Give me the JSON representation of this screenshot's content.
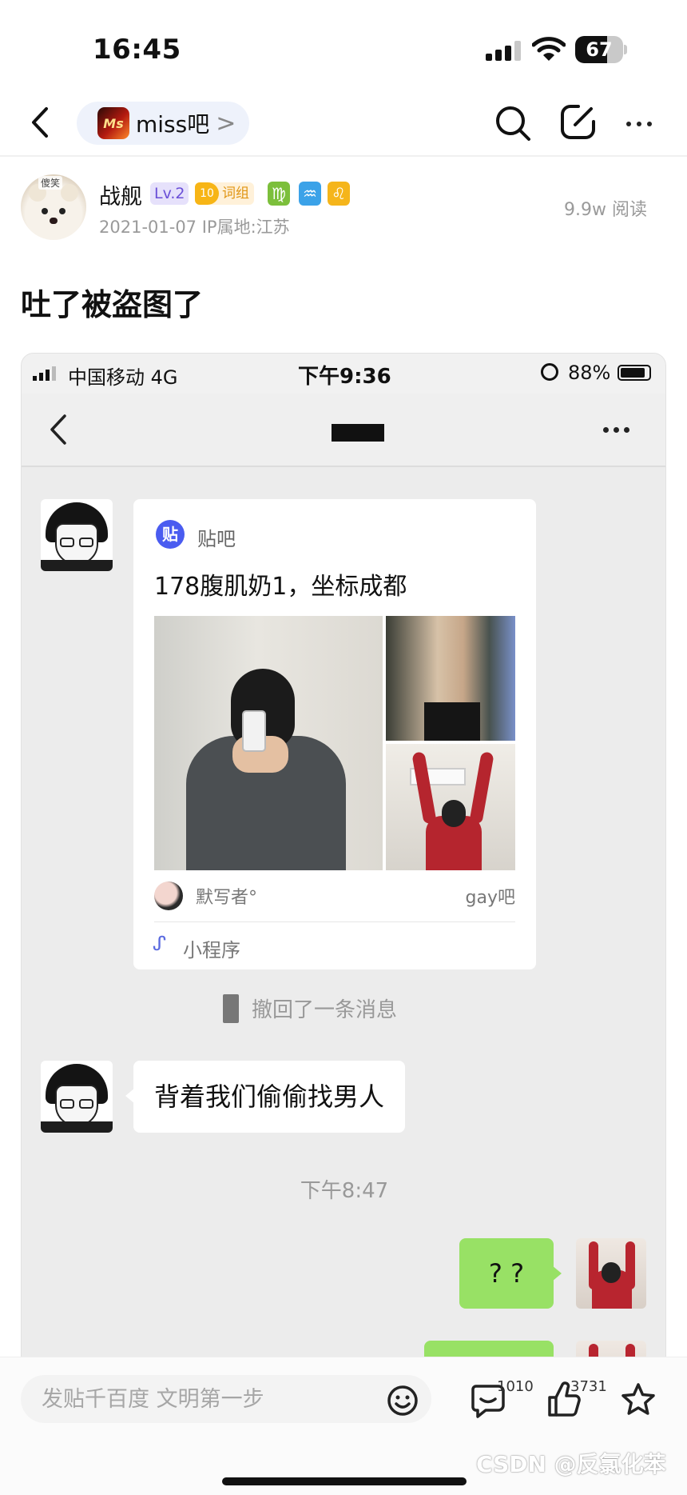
{
  "status_bar": {
    "time": "16:45",
    "battery": "67",
    "battery_level": 0.67
  },
  "nav": {
    "forum_name": "miss吧",
    "forum_chevron": ">",
    "forum_logo_text": "Ms"
  },
  "author": {
    "avatar_tag": "傻笑",
    "name": "战舰",
    "level": "Lv.2",
    "group_level": "10",
    "group_label": "词组",
    "zodiac": {
      "virgo": "♍",
      "aquarius": "♒",
      "leo": "♌"
    },
    "meta": "2021-01-07   IP属地:江苏",
    "reads": "9.9w 阅读"
  },
  "post": {
    "title": "吐了被盗图了"
  },
  "screenshot": {
    "carrier": "中国移动  4G",
    "time": "下午9:36",
    "battery_pct": "88%",
    "battery_level": 0.88,
    "card": {
      "app_icon_text": "贴",
      "app_name": "贴吧",
      "title": "178腹肌奶1，坐标成都",
      "author": "默写者°",
      "forum": "gay吧",
      "mini_icon": "ᔑ",
      "mini_label": "小程序"
    },
    "recall_text": "撤回了一条消息",
    "bubble_left": "背着我们偷偷找男人",
    "chat_time": "下午8:47",
    "bubble_right": "? ?"
  },
  "bottom": {
    "placeholder": "发贴千百度 文明第一步",
    "comment_count": "1010",
    "like_count": "3731",
    "watermark": "CSDN @反氯化苯"
  },
  "colors": {
    "accent_green": "#98e165",
    "chip_bg": "#eef2fb",
    "level_purple": "#6a4fd8"
  },
  "icons": [
    "back-icon",
    "search-icon",
    "edit-icon",
    "more-icon",
    "emoji-icon",
    "comment-icon",
    "like-icon",
    "star-icon"
  ]
}
